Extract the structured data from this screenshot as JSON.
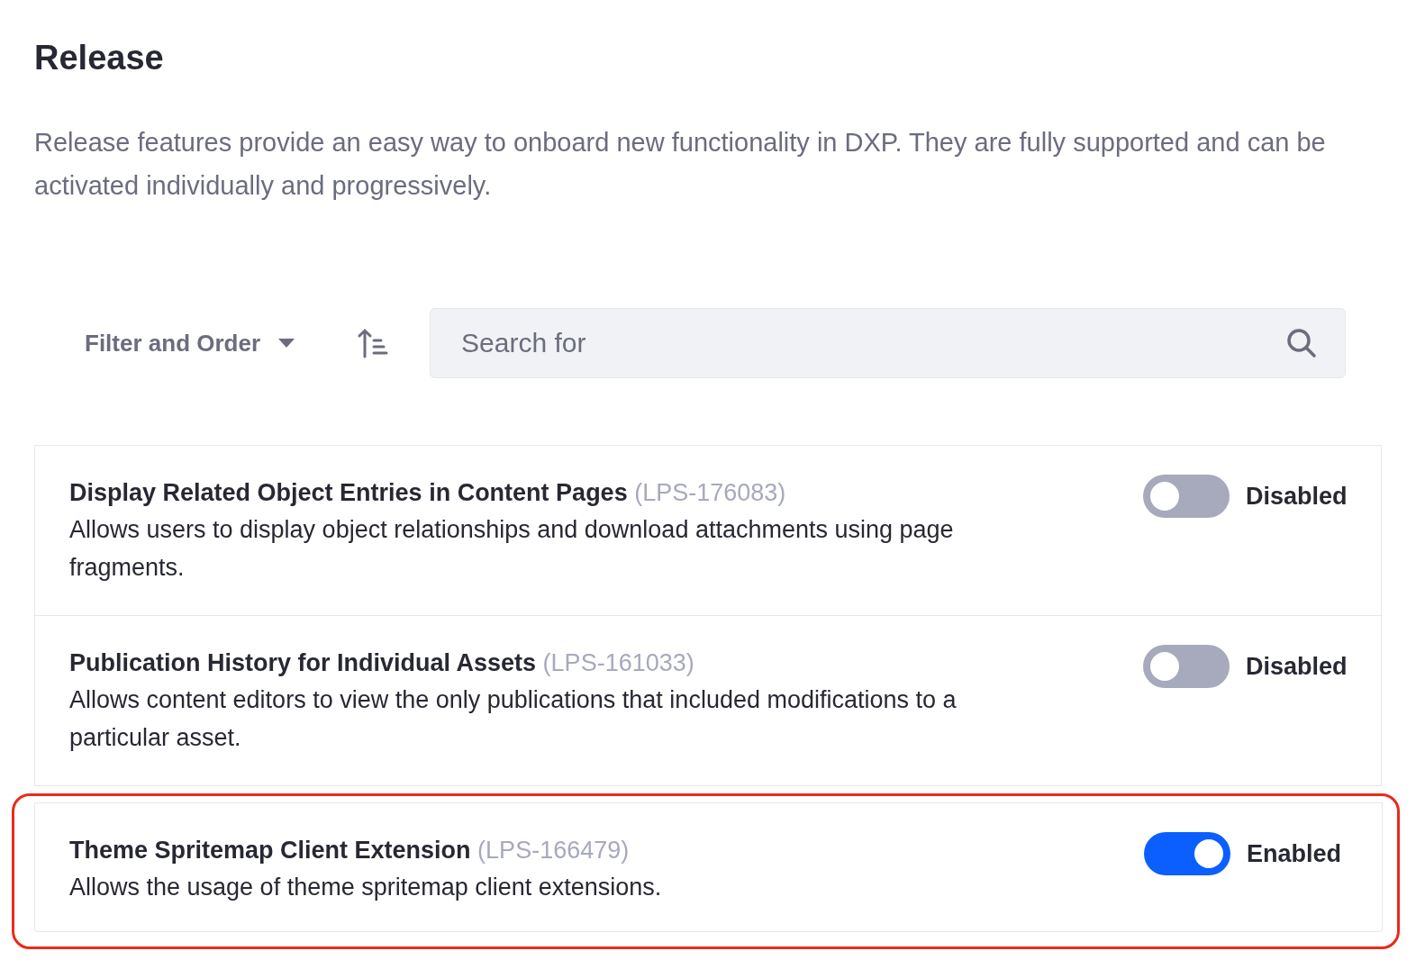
{
  "title": "Release",
  "description": "Release features provide an easy way to onboard new functionality in DXP. They are fully supported and can be activated individually and progressively.",
  "toolbar": {
    "filter_label": "Filter and Order",
    "search": {
      "placeholder": "Search for"
    }
  },
  "features": [
    {
      "name": "Display Related Object Entries in Content Pages",
      "code": "(LPS-176083)",
      "description": "Allows users to display object relationships and download attachments using page fragments.",
      "on": false,
      "status": "Disabled",
      "highlighted": false
    },
    {
      "name": "Publication History for Individual Assets",
      "code": "(LPS-161033)",
      "description": "Allows content editors to view the only publications that included modifications to a particular asset.",
      "on": false,
      "status": "Disabled",
      "highlighted": false
    },
    {
      "name": "Theme Spritemap Client Extension",
      "code": "(LPS-166479)",
      "description": "Allows the usage of theme spritemap client extensions.",
      "on": true,
      "status": "Enabled",
      "highlighted": true
    }
  ]
}
